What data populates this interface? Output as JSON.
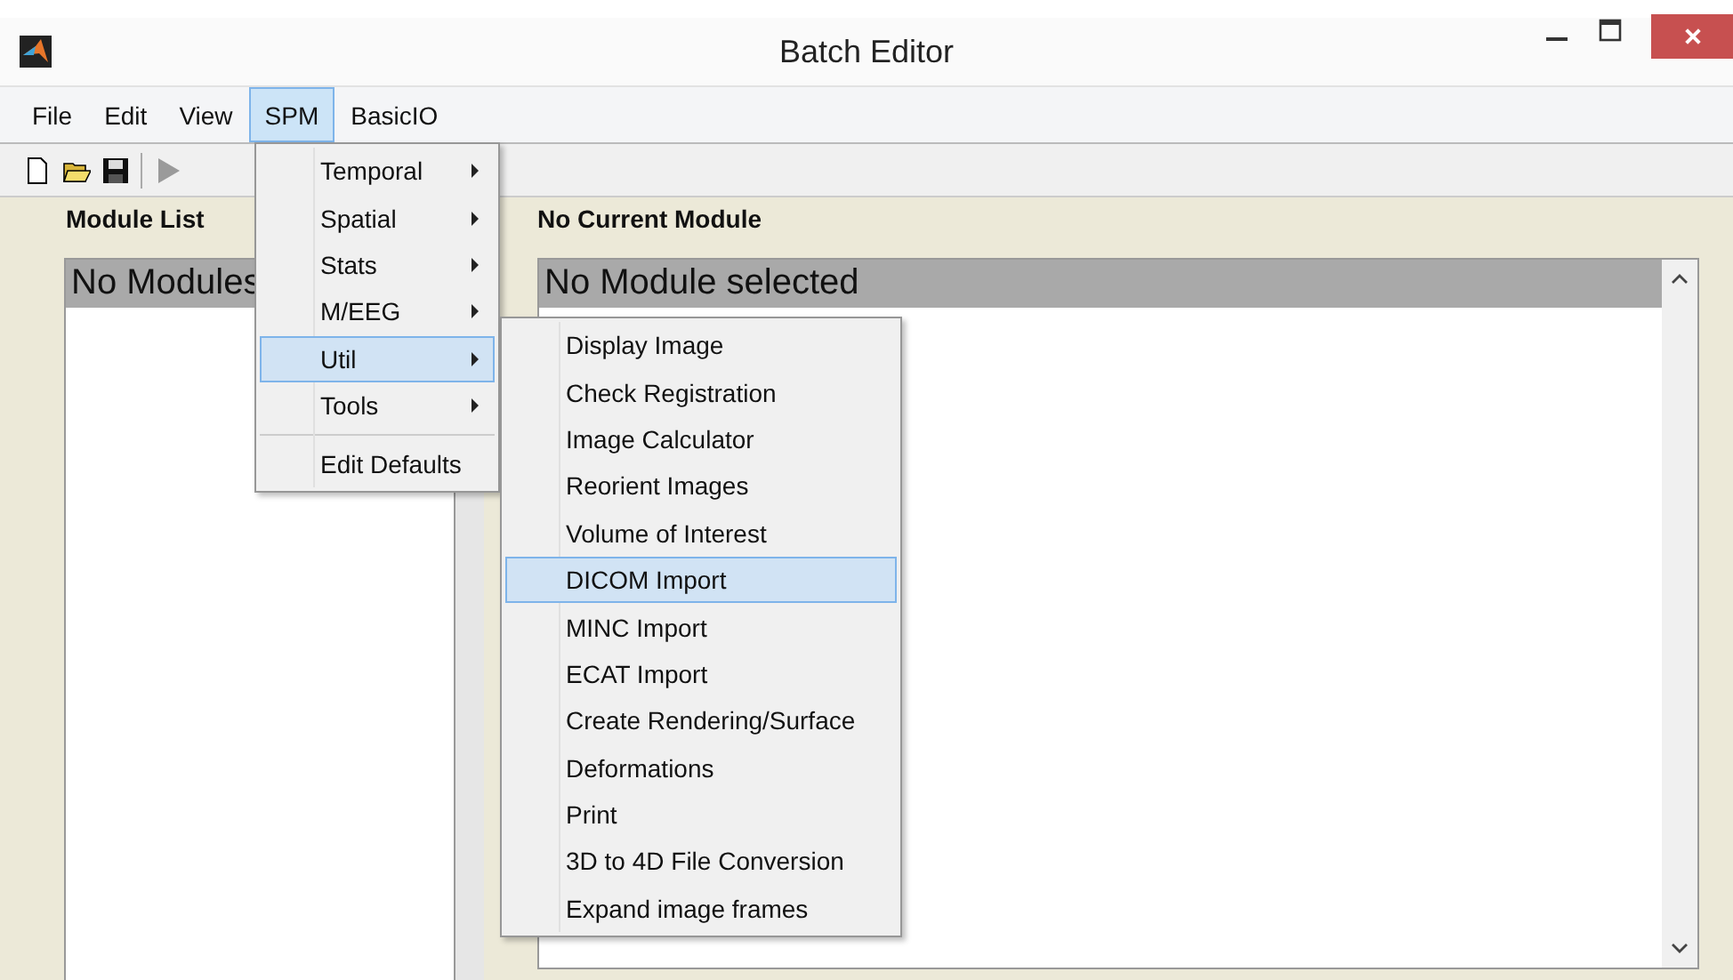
{
  "window": {
    "title": "Batch Editor"
  },
  "menu_bar": [
    {
      "label": "File",
      "selected": false
    },
    {
      "label": "Edit",
      "selected": false
    },
    {
      "label": "View",
      "selected": false
    },
    {
      "label": "SPM",
      "selected": true
    },
    {
      "label": "BasicIO",
      "selected": false
    }
  ],
  "toolbar": {
    "run_disabled": true
  },
  "module_list": {
    "label": "Module List",
    "header": "No Modules"
  },
  "current_module": {
    "label": "No Current Module",
    "header": "No Module selected"
  },
  "spm_menu": [
    {
      "label": "Temporal",
      "kind": "submenu",
      "selected": false,
      "separator_before": false
    },
    {
      "label": "Spatial",
      "kind": "submenu",
      "selected": false,
      "separator_before": false
    },
    {
      "label": "Stats",
      "kind": "submenu",
      "selected": false,
      "separator_before": false
    },
    {
      "label": "M/EEG",
      "kind": "submenu",
      "selected": false,
      "separator_before": false
    },
    {
      "label": "Util",
      "kind": "submenu",
      "selected": true,
      "separator_before": false
    },
    {
      "label": "Tools",
      "kind": "submenu",
      "selected": false,
      "separator_before": false
    },
    {
      "label": "Edit Defaults",
      "kind": "command",
      "selected": false,
      "separator_before": true
    }
  ],
  "util_menu": [
    {
      "label": "Display Image",
      "selected": false
    },
    {
      "label": "Check Registration",
      "selected": false
    },
    {
      "label": "Image Calculator",
      "selected": false
    },
    {
      "label": "Reorient Images",
      "selected": false
    },
    {
      "label": "Volume of Interest",
      "selected": false
    },
    {
      "label": "DICOM Import",
      "selected": true
    },
    {
      "label": "MINC Import",
      "selected": false
    },
    {
      "label": "ECAT Import",
      "selected": false
    },
    {
      "label": "Create Rendering/Surface",
      "selected": false
    },
    {
      "label": "Deformations",
      "selected": false
    },
    {
      "label": "Print",
      "selected": false
    },
    {
      "label": "3D to 4D File Conversion",
      "selected": false
    },
    {
      "label": "Expand image frames",
      "selected": false
    }
  ]
}
